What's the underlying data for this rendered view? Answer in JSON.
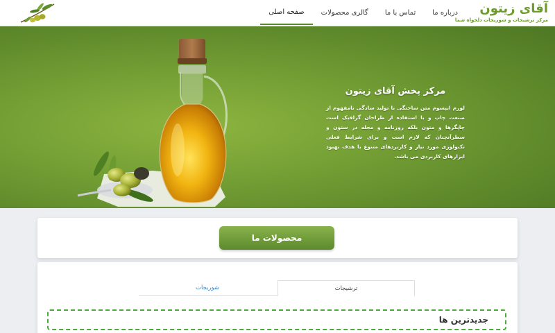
{
  "brand": {
    "title": "آقای زیتون",
    "subtitle": "مرکز ترشیجات و شوریجات دلخواه شما"
  },
  "nav": {
    "items": [
      {
        "label": "صفحه اصلی",
        "active": true
      },
      {
        "label": "گالری محصولات",
        "active": false
      },
      {
        "label": "تماس با ما",
        "active": false
      },
      {
        "label": "درباره ما",
        "active": false
      }
    ]
  },
  "hero": {
    "title": "مرکز پخش آقای زیتون",
    "body": "لورم ایپسوم متن ساختگی با تولید سادگی نامفهوم از صنعت چاپ و با استفاده از طراحان گرافیک است چاپگرها و متون بلکه روزنامه و مجله در ستون و سطرآنچنان که لازم است و برای شرایط فعلی تکنولوژی مورد نیاز و کاربردهای متنوع با هدف بهبود ابزارهای کاربردی می باشد.",
    "image": "olive-oil-bottle"
  },
  "products": {
    "button_label": "محصولات ما"
  },
  "tabs": {
    "pickles": "ترشیجات",
    "salty": "شوریجات",
    "active": "pickles"
  },
  "latest": {
    "title": "جدیدترین ها"
  },
  "colors": {
    "brand_green": "#6d9b2a",
    "hero_green": "#76a136",
    "button_green": "#6f9c3a",
    "tab_link_blue": "#3b84c4",
    "dashed_border": "#4caa3a"
  }
}
